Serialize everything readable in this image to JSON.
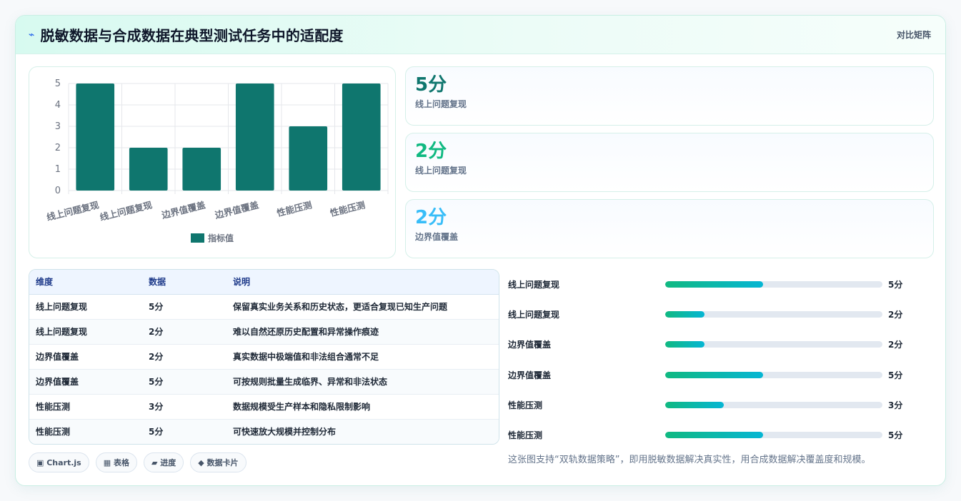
{
  "header": {
    "icon": "bolt-icon",
    "title": "脱敏数据与合成数据在典型测试任务中的适配度",
    "tag": "对比矩阵"
  },
  "chart_data": {
    "type": "bar",
    "categories": [
      "线上问题复现",
      "线上问题复现",
      "边界值覆盖",
      "边界值覆盖",
      "性能压测",
      "性能压测"
    ],
    "series": [
      {
        "name": "指标值",
        "values": [
          5,
          2,
          2,
          5,
          3,
          5
        ]
      }
    ],
    "ylim": [
      0,
      5
    ],
    "yticks": [
      "0",
      "1",
      "2",
      "3",
      "4",
      "5"
    ],
    "legend_position": "bottom",
    "grid": true,
    "bar_color": "#0f766e"
  },
  "stats": [
    {
      "value": "5分",
      "label": "线上问题复现",
      "color": "#0f766e"
    },
    {
      "value": "2分",
      "label": "线上问题复现",
      "color": "#10b981"
    },
    {
      "value": "2分",
      "label": "边界值覆盖",
      "color": "#38bdf8"
    }
  ],
  "table": {
    "headers": [
      "维度",
      "数据",
      "说明"
    ],
    "rows": [
      [
        "线上问题复现",
        "5分",
        "保留真实业务关系和历史状态，更适合复现已知生产问题"
      ],
      [
        "线上问题复现",
        "2分",
        "难以自然还原历史配置和异常操作痕迹"
      ],
      [
        "边界值覆盖",
        "2分",
        "真实数据中极端值和非法组合通常不足"
      ],
      [
        "边界值覆盖",
        "5分",
        "可按规则批量生成临界、异常和非法状态"
      ],
      [
        "性能压测",
        "3分",
        "数据规模受生产样本和隐私限制影响"
      ],
      [
        "性能压测",
        "5分",
        "可快速放大规模并控制分布"
      ]
    ]
  },
  "progress": [
    {
      "label": "线上问题复现",
      "value": "5分",
      "fraction": 0.45
    },
    {
      "label": "线上问题复现",
      "value": "2分",
      "fraction": 0.18
    },
    {
      "label": "边界值覆盖",
      "value": "2分",
      "fraction": 0.18
    },
    {
      "label": "边界值覆盖",
      "value": "5分",
      "fraction": 0.45
    },
    {
      "label": "性能压测",
      "value": "3分",
      "fraction": 0.27
    },
    {
      "label": "性能压测",
      "value": "5分",
      "fraction": 0.45
    }
  ],
  "chips": [
    "▣ Chart.js",
    "▦ 表格",
    "▰ 进度",
    "◆ 数据卡片"
  ],
  "note": "这张图支持“双轨数据策略”，即用脱敏数据解决真实性，用合成数据解决覆盖度和规模。"
}
